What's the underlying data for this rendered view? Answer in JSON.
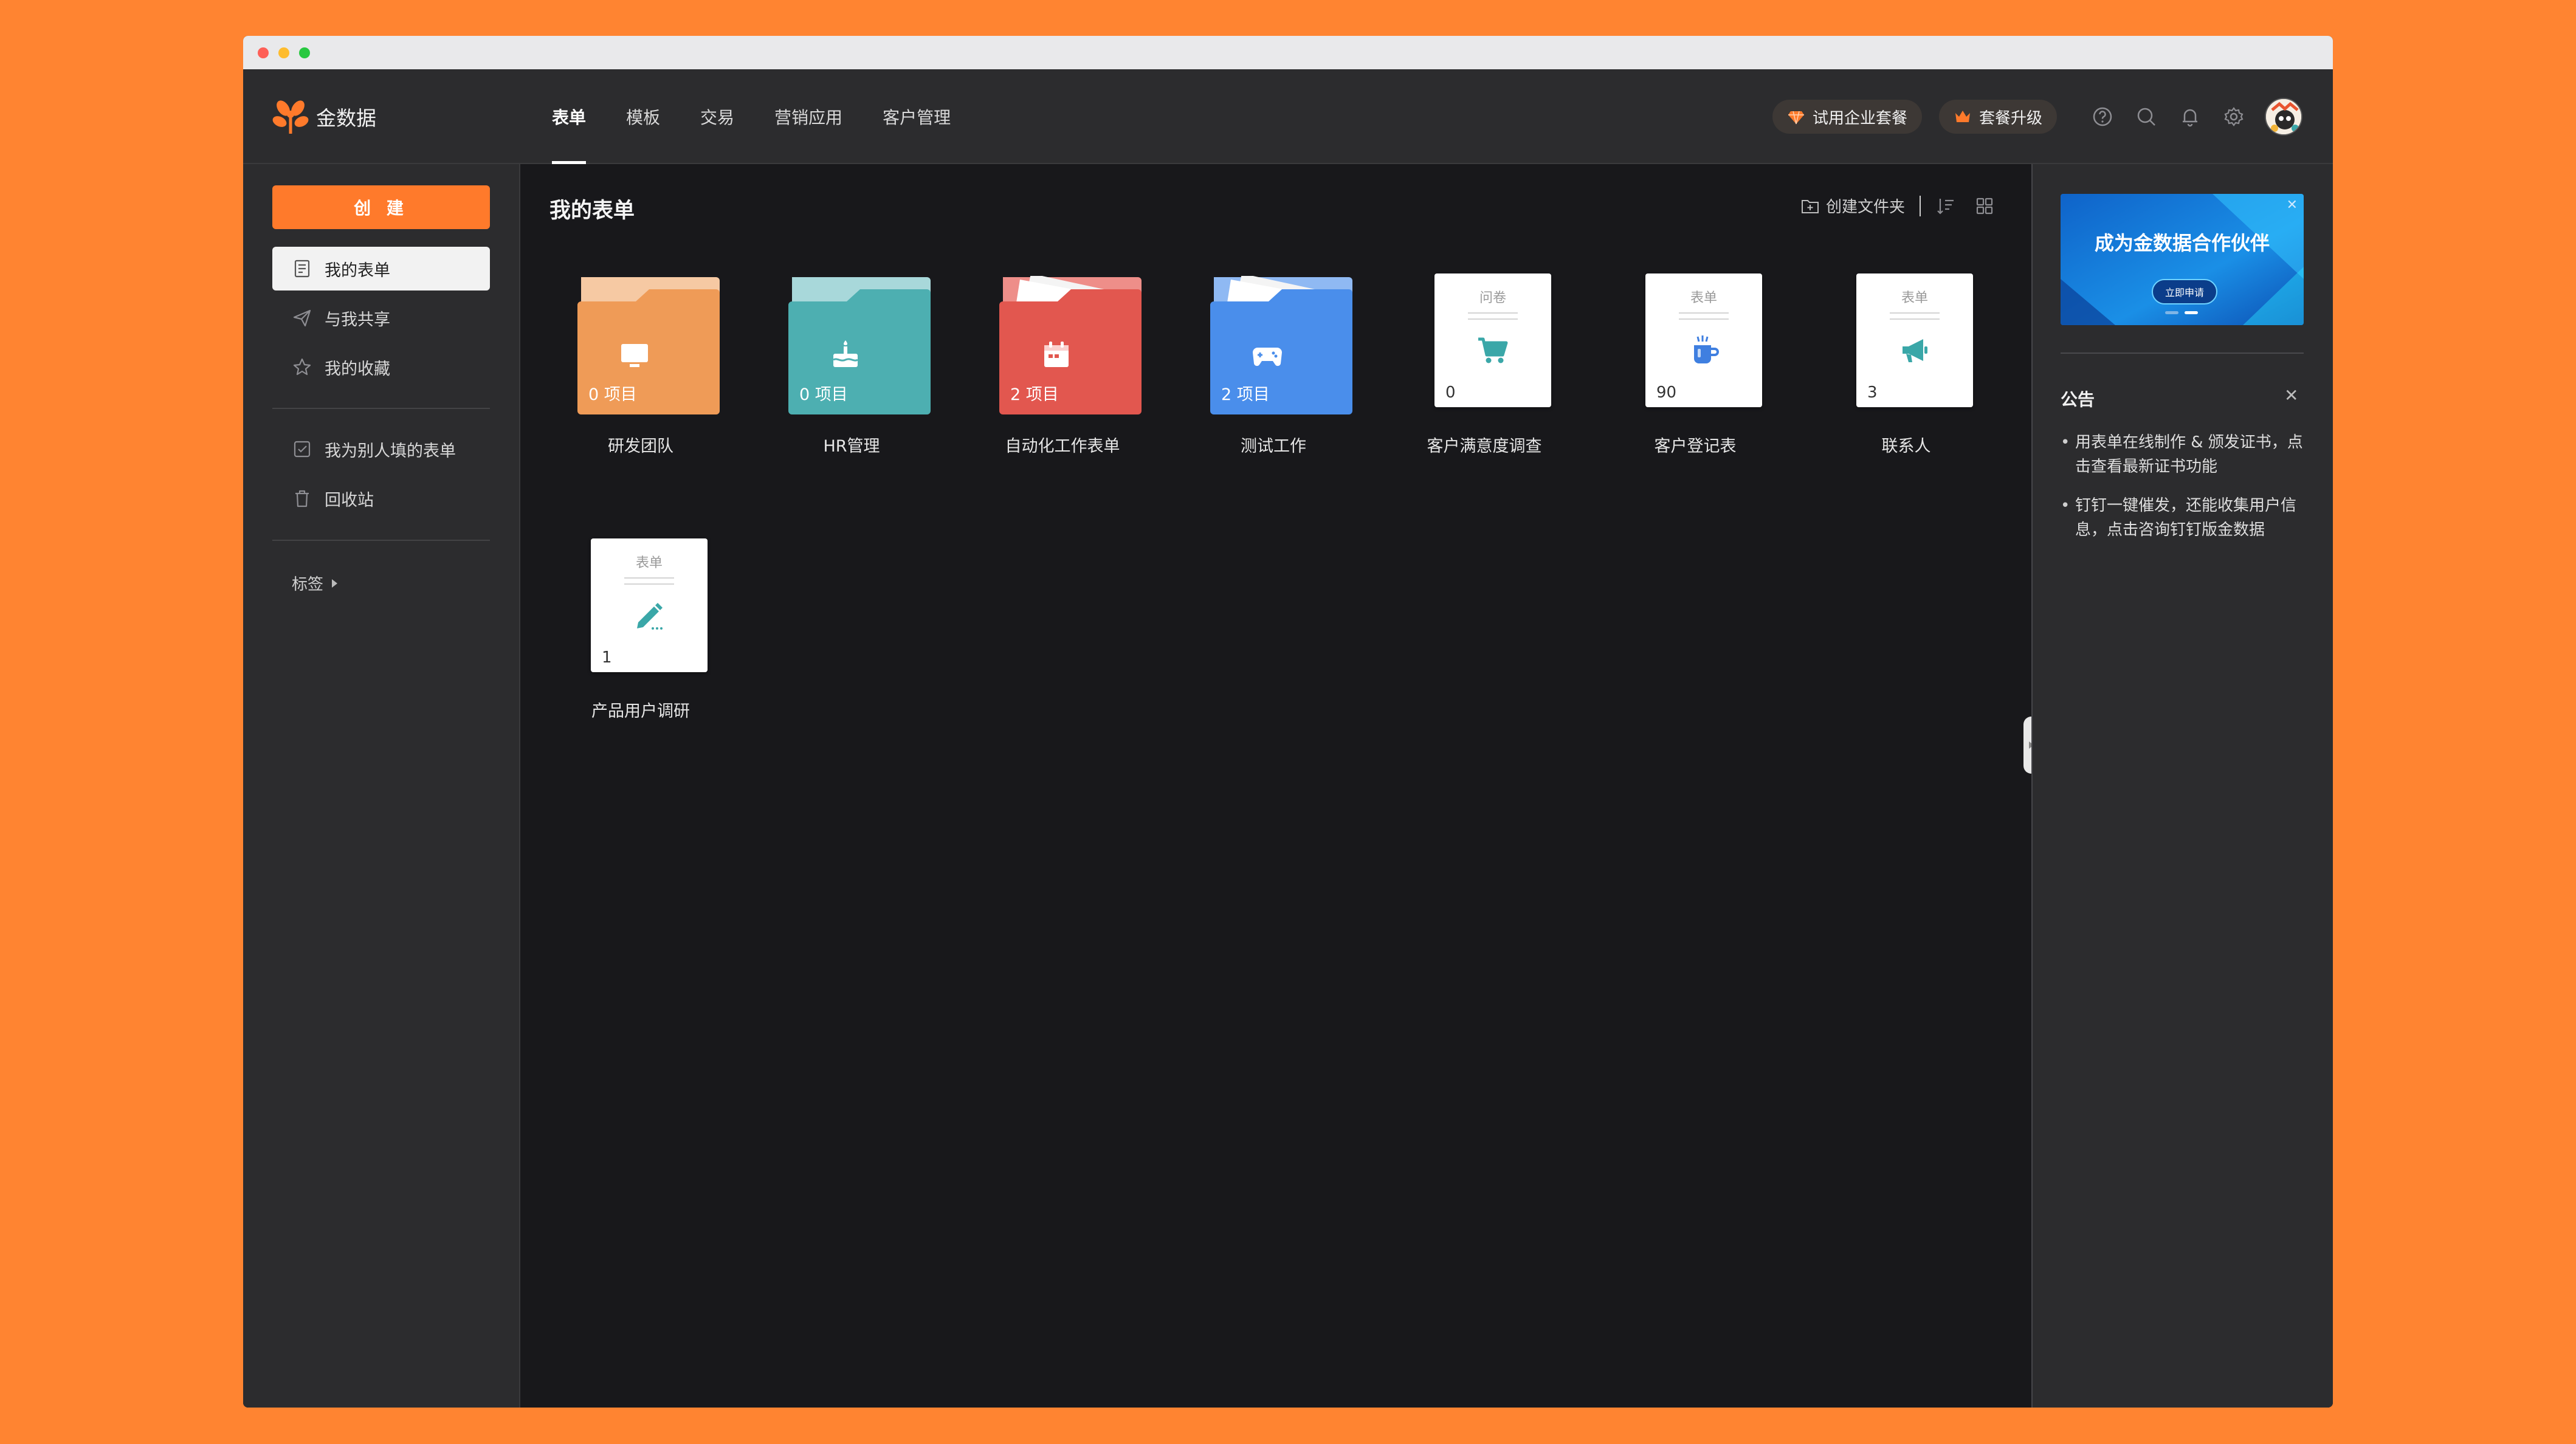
{
  "brand": {
    "name": "金数据"
  },
  "nav": {
    "tabs": [
      {
        "label": "表单",
        "active": true
      },
      {
        "label": "模板"
      },
      {
        "label": "交易"
      },
      {
        "label": "营销应用"
      },
      {
        "label": "客户管理"
      }
    ],
    "trial_button": "试用企业套餐",
    "upgrade_button": "套餐升级",
    "icons": [
      "help-icon",
      "search-icon",
      "bell-icon",
      "settings-icon"
    ]
  },
  "sidebar": {
    "create_label": "创 建",
    "items": [
      {
        "label": "我的表单",
        "icon": "form-icon",
        "active": true
      },
      {
        "label": "与我共享",
        "icon": "paper-plane-icon"
      },
      {
        "label": "我的收藏",
        "icon": "star-icon"
      },
      {
        "label": "我为别人填的表单",
        "icon": "checkbox-icon"
      },
      {
        "label": "回收站",
        "icon": "trash-icon"
      }
    ],
    "tags_label": "标签"
  },
  "main": {
    "title": "我的表单",
    "create_folder_label": "创建文件夹",
    "folders": [
      {
        "name": "研发团队",
        "count": "0 项目",
        "color": "#EF9B57",
        "tab_color": "#F6C9A3",
        "icon": "monitor-icon"
      },
      {
        "name": "HR管理",
        "count": "0 项目",
        "color": "#4DAFB1",
        "tab_color": "#A8D8DA",
        "icon": "cake-icon"
      },
      {
        "name": "自动化工作表单",
        "count": "2 项目",
        "color": "#E2574F",
        "tab_color": "#EE8E89",
        "icon": "calendar-icon"
      },
      {
        "name": "测试工作",
        "count": "2 项目",
        "color": "#4A8EEB",
        "tab_color": "#8FB9F3",
        "icon": "gamepad-icon"
      }
    ],
    "forms": [
      {
        "name": "客户满意度调查",
        "type": "问卷",
        "count": "0",
        "icon": "cart-icon",
        "icon_color": "#3AA7A8"
      },
      {
        "name": "客户登记表",
        "type": "表单",
        "count": "90",
        "icon": "coffee-cup-icon",
        "icon_color": "#3F7FE0"
      },
      {
        "name": "联系人",
        "type": "表单",
        "count": "3",
        "icon": "megaphone-icon",
        "icon_color": "#3AA7A8"
      },
      {
        "name": "产品用户调研",
        "type": "表单",
        "count": "1",
        "icon": "pencil-icon",
        "icon_color": "#3AA7A8"
      }
    ]
  },
  "right_panel": {
    "banner_title": "成为金数据合作伙伴",
    "banner_button": "立即申请",
    "notice_title": "公告",
    "notices": [
      "用表单在线制作 & 颁发证书，点击查看最新证书功能",
      "钉钉一键催发，还能收集用户信息，点击咨询钉钉版金数据"
    ]
  },
  "colors": {
    "accent": "#FF7A2B",
    "background": "#FF8431"
  }
}
